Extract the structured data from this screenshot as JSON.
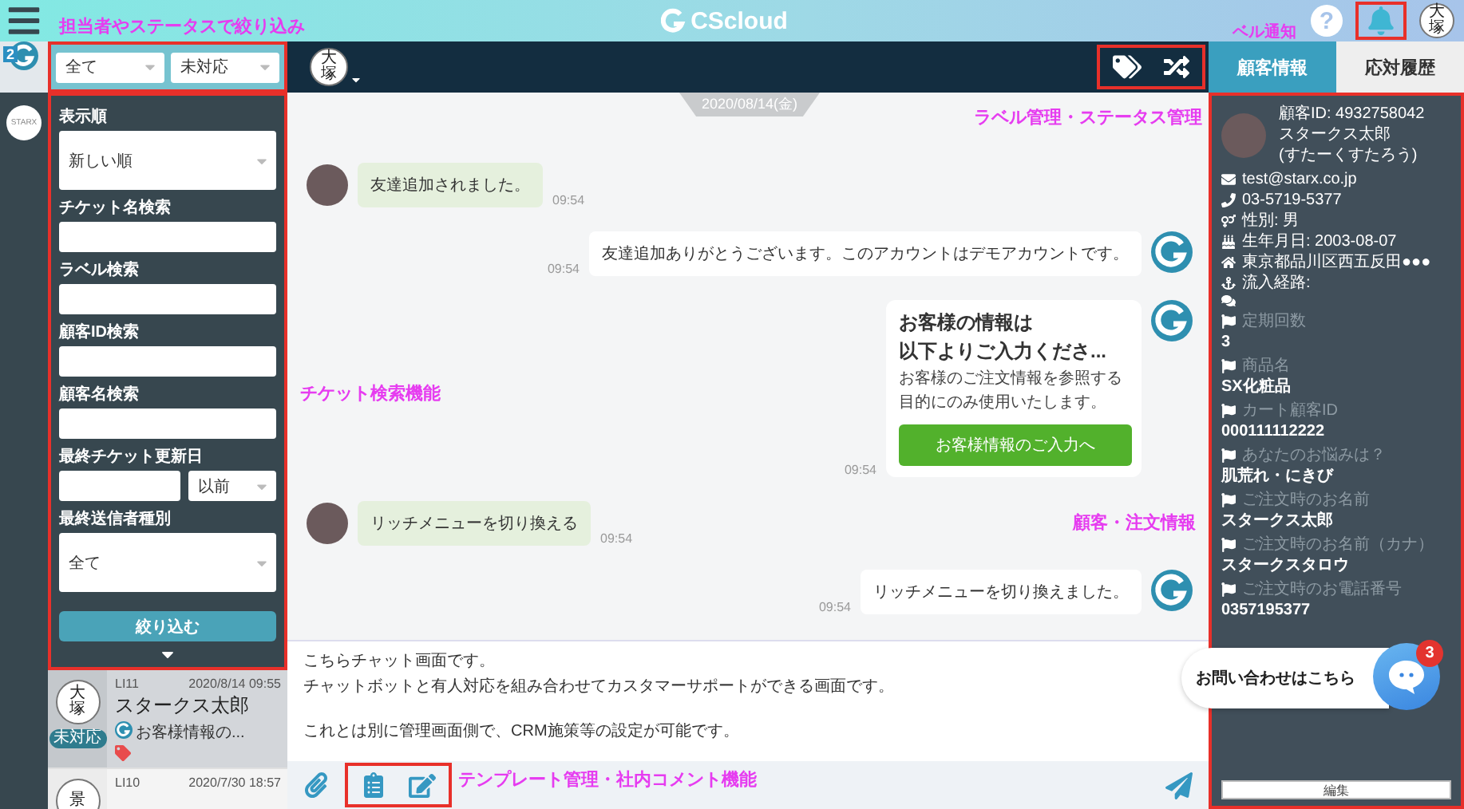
{
  "top_bar": {
    "logo": "CScloud",
    "help": "?",
    "user_avatar": "大塚"
  },
  "annotations": [
    {
      "kind": "filter",
      "text": "担当者やステータスで絞り込み"
    },
    {
      "kind": "bell",
      "text": "ベル通知"
    },
    {
      "kind": "label",
      "text": "ラベル管理・ステータス管理"
    },
    {
      "kind": "search",
      "text": "チケット検索機能"
    },
    {
      "kind": "customer",
      "text": "顧客・注文情報"
    },
    {
      "kind": "template",
      "text": "テンプレート管理・社内コメント機能"
    }
  ],
  "rail": {
    "badge": "2",
    "org_logo": "STARX"
  },
  "filters": {
    "assignee": "全て",
    "status": "未対応",
    "fields": [
      {
        "kind": "select",
        "label": "表示順",
        "value": "新しい順"
      },
      {
        "kind": "text",
        "label": "チケット名検索"
      },
      {
        "kind": "text",
        "label": "ラベル検索"
      },
      {
        "kind": "text",
        "label": "顧客ID検索"
      },
      {
        "kind": "text",
        "label": "顧客名検索"
      },
      {
        "kind": "date",
        "label": "最終チケット更新日",
        "option": "以前"
      },
      {
        "kind": "select",
        "label": "最終送信者種別",
        "value": "全て"
      }
    ],
    "submit": "絞り込む"
  },
  "tickets": [
    {
      "id": "LI11",
      "time": "2020/8/14 09:55",
      "avatar": "大塚",
      "name": "スタークス太郎",
      "preview": "お客様情報の...",
      "status": "未対応",
      "tagged": true,
      "selected": true
    },
    {
      "id": "LI10",
      "time": "2020/7/30 18:57",
      "avatar": "景",
      "selected": false
    }
  ],
  "chat": {
    "assignee_avatar": "大塚",
    "date": "2020/08/14(金)",
    "messages": [
      {
        "kind": "text",
        "outgoing": false,
        "text": "友達追加されました。",
        "time": "09:54"
      },
      {
        "kind": "text",
        "outgoing": true,
        "text": "友達追加ありがとうございます。このアカウントはデモアカウントです。",
        "time": "09:54"
      },
      {
        "kind": "card",
        "outgoing": true,
        "title": [
          "お客様の情報は",
          "以下よりご入力くださ..."
        ],
        "body": "お客様のご注文情報を参照する目的にのみ使用いたします。",
        "button": "お客様情報のご入力へ",
        "time": "09:54"
      },
      {
        "kind": "text",
        "outgoing": false,
        "text": "リッチメニューを切り換える",
        "time": "09:54"
      },
      {
        "kind": "text",
        "outgoing": true,
        "text": "リッチメニューを切り換えました。",
        "time": "09:54"
      }
    ],
    "composer": {
      "paragraphs": [
        [
          "こちらチャット画面です。",
          "チャットボットと有人対応を組み合わせてカスタマーサポートができる画面です。"
        ],
        [
          "これとは別に管理画面側で、CRM施策等の設定が可能です。"
        ]
      ]
    }
  },
  "customer": {
    "tabs": [
      {
        "label": "顧客情報",
        "selected": true
      },
      {
        "label": "応対履歴",
        "selected": false
      }
    ],
    "id_line": "顧客ID: 4932758042",
    "name": "スタークス太郎",
    "kana": "(すたーくすたろう)",
    "contacts": [
      {
        "kind": "email",
        "text": "test@starx.co.jp"
      },
      {
        "kind": "phone",
        "text": "03-5719-5377"
      },
      {
        "kind": "gender",
        "text": "性別: 男"
      },
      {
        "kind": "birthday",
        "text": "生年月日: 2003-08-07"
      },
      {
        "kind": "address",
        "text": "東京都品川区西五反田●●●"
      },
      {
        "kind": "source",
        "text": "流入経路:"
      },
      {
        "kind": "chat"
      }
    ],
    "fields": [
      {
        "label": "定期回数",
        "value": "3"
      },
      {
        "label": "商品名",
        "value": "SX化粧品"
      },
      {
        "label": "カート顧客ID",
        "value": "000111112222"
      },
      {
        "label": "あなたのお悩みは？",
        "value": "肌荒れ・にきび"
      },
      {
        "label": "ご注文時のお名前",
        "value": "スタークス太郎"
      },
      {
        "label": "ご注文時のお名前（カナ）",
        "value": "スタークスタロウ"
      },
      {
        "label": "ご注文時のお電話番号",
        "value": "0357195377"
      }
    ],
    "edit_button": "編集"
  },
  "widget": {
    "label": "お問い合わせはこちら",
    "badge": "3"
  }
}
